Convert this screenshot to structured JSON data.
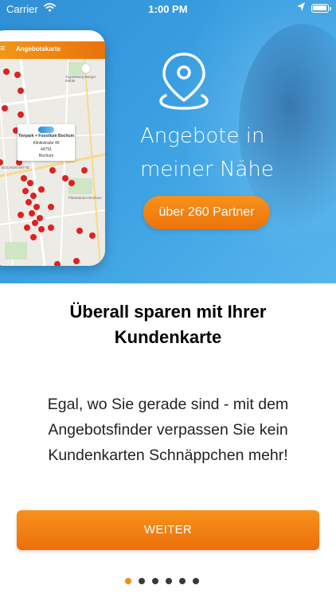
{
  "status_bar": {
    "carrier": "Carrier",
    "time": "1:00 PM"
  },
  "phone_mockup": {
    "app_title": "Angebotskarte",
    "card": {
      "name": "Tierpark + Fossilium Bochum",
      "street": "Klinikstraße 49",
      "zip": "44791",
      "city": "Bochum"
    },
    "map_labels": [
      "Tippelsberg-Berger Mühle",
      "Planetarium Bochum",
      "BOCHUM MITTE"
    ]
  },
  "hero": {
    "headline_line1": "Angebote in",
    "headline_line2": "meiner Nähe",
    "partner_button": "über 260 Partner"
  },
  "content": {
    "title_line1": "Überall sparen mit Ihrer",
    "title_line2": "Kundenkarte",
    "body_line1": "Egal, wo Sie gerade sind - mit dem",
    "body_line2": "Angebotsfinder verpassen Sie kein",
    "body_line3": "Kundenkarten Schnäppchen mehr!"
  },
  "weiter_button": "WEITER",
  "pager": {
    "total": 6,
    "active_index": 0
  },
  "colors": {
    "accent_orange": "#f28a1a",
    "hero_blue": "#3aa0e2"
  }
}
